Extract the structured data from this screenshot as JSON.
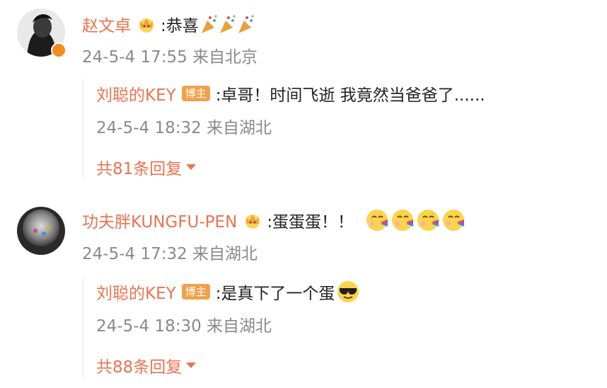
{
  "comments": [
    {
      "user": "赵文卓",
      "text": ":恭喜",
      "meta": "24-5-4 17:55 来自北京",
      "reply": {
        "user": "刘聪的KEY",
        "tag": "博主",
        "text": ":卓哥！时间飞逝 我竟然当爸爸了......",
        "meta": "24-5-4 18:32 来自湖北"
      },
      "more": "共81条回复"
    },
    {
      "user": "功夫胖KUNGFU-PEN",
      "text": ":蛋蛋蛋！！",
      "meta": "24-5-4 17:32 来自湖北",
      "reply": {
        "user": "刘聪的KEY",
        "tag": "博主",
        "text": ":是真下了一个蛋",
        "meta": "24-5-4 18:30 来自湖北"
      },
      "more": "共88条回复"
    }
  ],
  "colors": {
    "name": "#eb7350",
    "meta": "#8a8a8a",
    "bozhu": "#f1a04c",
    "verified": "#f58a1f"
  },
  "icons": [
    "crown-icon",
    "party-popper-icon",
    "rainbow-kiss-emoji-icon",
    "sunglasses-emoji-icon",
    "dropdown-triangle-icon",
    "verified-badge-icon"
  ]
}
